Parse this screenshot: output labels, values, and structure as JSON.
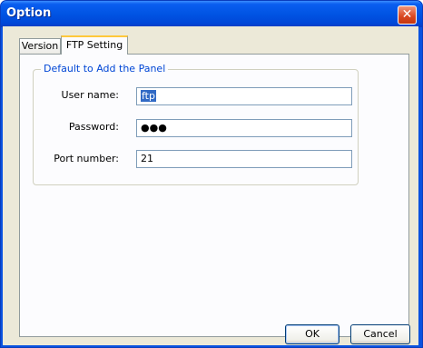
{
  "window": {
    "title": "Option",
    "close_symbol": "✕"
  },
  "tabs": [
    {
      "label": "Version",
      "selected": false
    },
    {
      "label": "FTP Setting",
      "selected": true
    }
  ],
  "group": {
    "title": "Default to Add the Panel",
    "user_name": {
      "label": "User name:",
      "value": "ftp"
    },
    "password": {
      "label": "Password:",
      "value": "●●●"
    },
    "port": {
      "label": "Port number:",
      "value": "21"
    }
  },
  "buttons": {
    "ok": "OK",
    "cancel": "Cancel"
  }
}
